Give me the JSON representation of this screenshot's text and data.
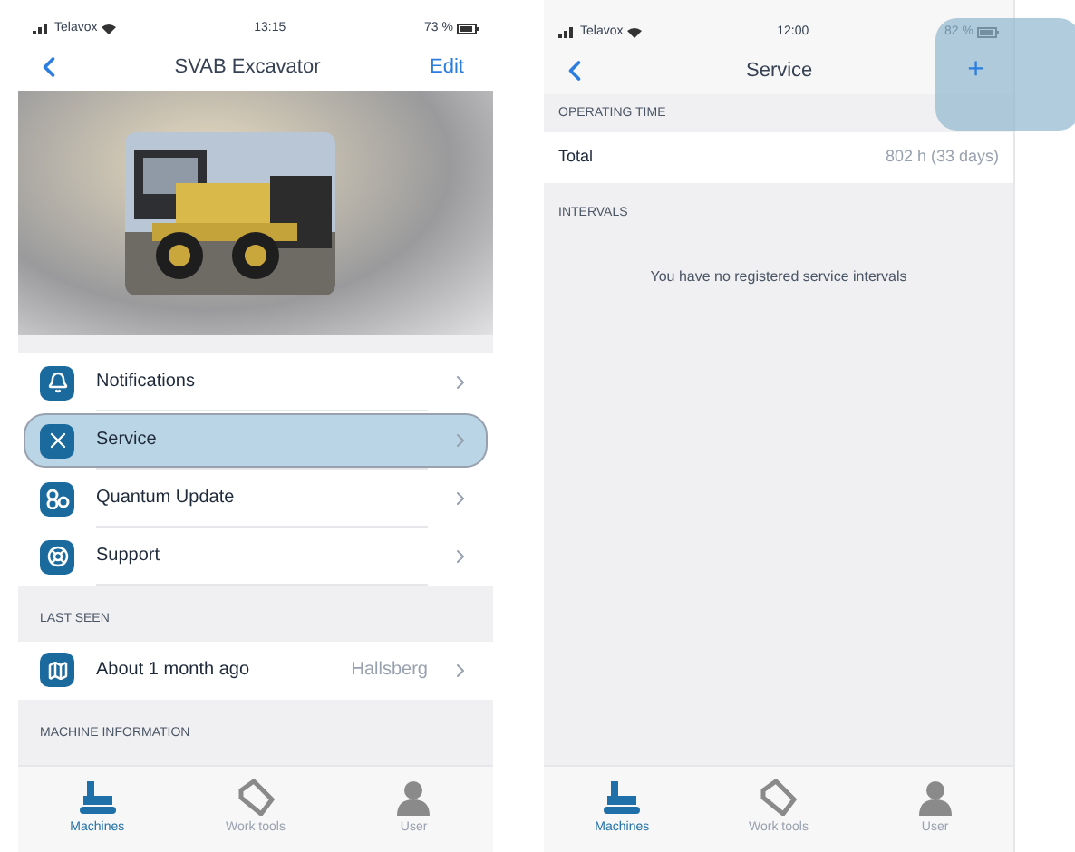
{
  "left_screen": {
    "status_bar": {
      "carrier": "Telavox",
      "time": "13:15",
      "battery": "73 %"
    },
    "nav": {
      "title": "SVAB Excavator",
      "action": "Edit"
    },
    "menu": [
      {
        "label": "Notifications",
        "kind": "bell",
        "highlighted": false
      },
      {
        "label": "Service",
        "kind": "tools",
        "highlighted": true
      },
      {
        "label": "Quantum Update",
        "kind": "quantum",
        "highlighted": false
      },
      {
        "label": "Support",
        "kind": "support",
        "highlighted": false
      }
    ],
    "last_seen": {
      "header": "LAST SEEN",
      "label": "About 1 month ago",
      "value": "Hallsberg"
    },
    "machine_info": {
      "header": "MACHINE INFORMATION"
    },
    "tabs": [
      {
        "label": "Machines",
        "kind": "machine",
        "selected": true
      },
      {
        "label": "Work tools",
        "kind": "bucket",
        "selected": false
      },
      {
        "label": "User",
        "kind": "user",
        "selected": false
      }
    ]
  },
  "right_screen": {
    "status_bar": {
      "carrier": "Telavox",
      "time": "12:00",
      "battery": "82 %"
    },
    "nav": {
      "title": "Service",
      "add": "+",
      "add_highlighted": true
    },
    "operating_time": {
      "header": "OPERATING TIME",
      "label": "Total",
      "value": "802 h (33 days)"
    },
    "intervals": {
      "header": "INTERVALS",
      "empty_message": "You have no registered service intervals"
    },
    "tabs": [
      {
        "label": "Machines",
        "kind": "machine",
        "selected": true
      },
      {
        "label": "Work tools",
        "kind": "bucket",
        "selected": false
      },
      {
        "label": "User",
        "kind": "user",
        "selected": false
      }
    ]
  }
}
